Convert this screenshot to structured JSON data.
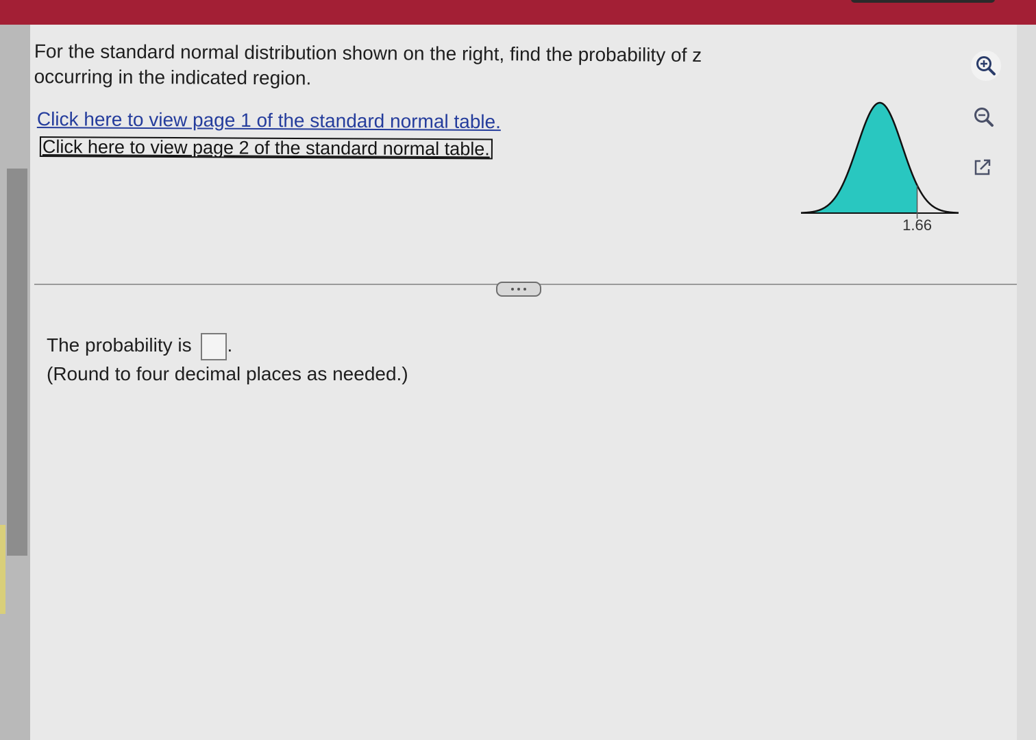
{
  "question": {
    "text": "For the standard normal distribution shown on the right, find the probability of z occurring in the indicated region."
  },
  "links": {
    "table_page1": "Click here to view page 1 of the standard normal table.",
    "table_page2": "Click here to view page 2 of the standard normal table."
  },
  "answer": {
    "prompt": "The probability is",
    "value": "",
    "suffix": ".",
    "note": "(Round to four decimal places as needed.)"
  },
  "toolbar": {
    "zoom_in_icon": "zoom-in-icon",
    "zoom_out_icon": "zoom-out-icon",
    "popout_icon": "popout-icon"
  },
  "chart_data": {
    "type": "area",
    "distribution": "standard normal",
    "shaded_region": "left of z",
    "z_value": 1.66,
    "tick_labels": [
      "1.66"
    ],
    "fill_color": "#29c7c0",
    "curve_color": "#111111"
  }
}
